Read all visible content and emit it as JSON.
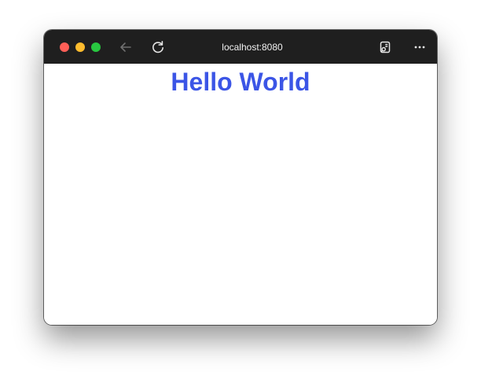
{
  "browser": {
    "address": "localhost:8080",
    "icons": {
      "back": "arrow-left-icon",
      "reload": "reload-icon",
      "reader": "reader-mode-icon",
      "more": "more-horizontal-icon"
    }
  },
  "page": {
    "heading": "Hello World"
  },
  "colors": {
    "titlebar": "#1f1f1f",
    "close": "#ff5f57",
    "minimize": "#febc2e",
    "zoom": "#28c840",
    "heading": "#3b55e6",
    "address_text": "#f2f2f2",
    "icon_active": "#e6e6e6",
    "icon_disabled": "#6f6f6f"
  }
}
